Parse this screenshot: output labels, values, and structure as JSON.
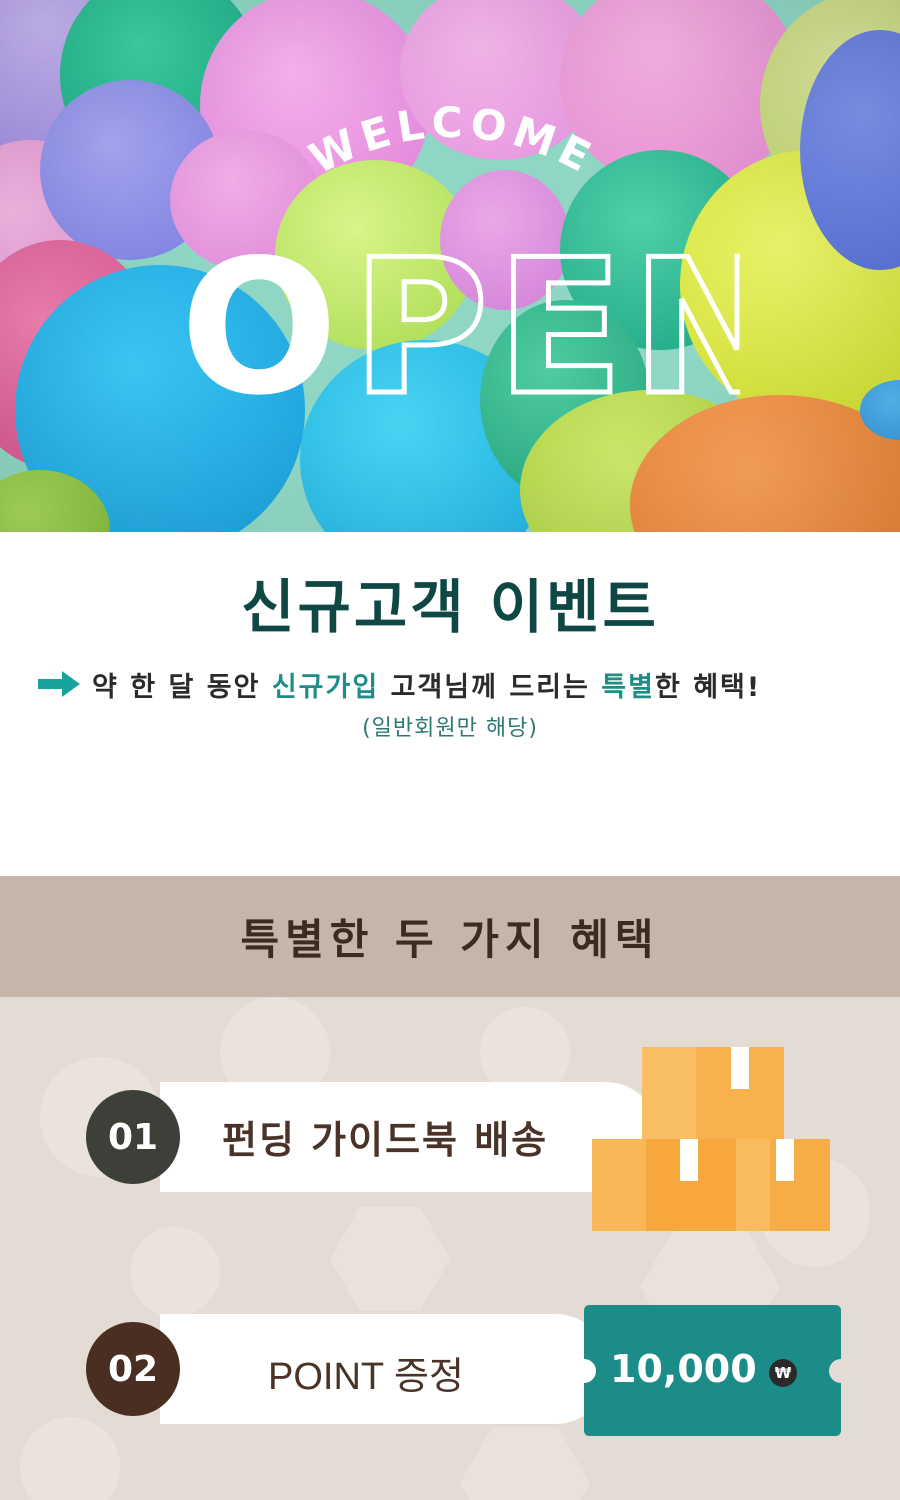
{
  "hero": {
    "welcome_text": "WELCOME",
    "open_first_letter": "O",
    "open_rest": "PEN"
  },
  "intro": {
    "title": "신규고객 이벤트",
    "line_part1": "약 한 달 동안 ",
    "line_highlight1": "신규가입",
    "line_part2": " 고객님께 드리는 ",
    "line_highlight2": "특별",
    "line_part3": "한 혜택!",
    "note": "(일반회원만 해당)"
  },
  "benefits": {
    "title": "특별한 두 가지 혜택",
    "items": [
      {
        "number": "01",
        "label": "펀딩 가이드북 배송",
        "icon": "boxes-icon"
      },
      {
        "number": "02",
        "label": "POINT 증정",
        "amount": "10,000",
        "currency_symbol": "₩",
        "icon": "ticket-icon"
      }
    ]
  },
  "colors": {
    "title_teal": "#0e4744",
    "highlight_teal": "#1f8d86",
    "header_bg": "#c4b6a8",
    "body_bg": "#e4dcd4",
    "ticket_teal": "#1b8c88",
    "box_orange": "#f6b04a"
  }
}
